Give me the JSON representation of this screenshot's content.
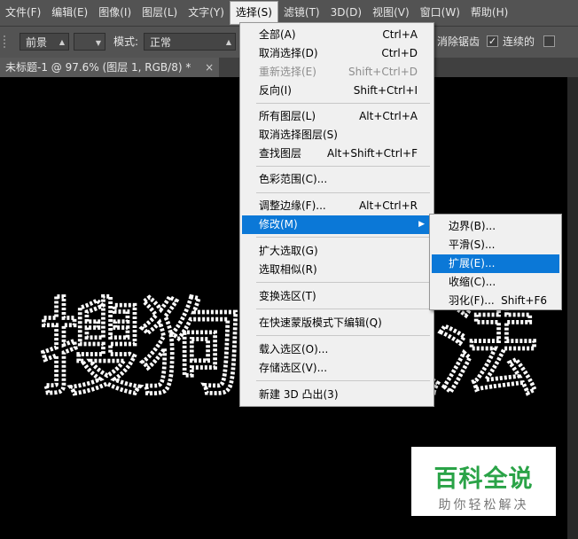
{
  "menubar": {
    "items": [
      {
        "label": "文件(F)",
        "active": false
      },
      {
        "label": "编辑(E)",
        "active": false
      },
      {
        "label": "图像(I)",
        "active": false
      },
      {
        "label": "图层(L)",
        "active": false
      },
      {
        "label": "文字(Y)",
        "active": false
      },
      {
        "label": "选择(S)",
        "active": true
      },
      {
        "label": "滤镜(T)",
        "active": false
      },
      {
        "label": "3D(D)",
        "active": false
      },
      {
        "label": "视图(V)",
        "active": false
      },
      {
        "label": "窗口(W)",
        "active": false
      },
      {
        "label": "帮助(H)",
        "active": false
      }
    ]
  },
  "options": {
    "foreground_select": "前景",
    "mode_label": "模式:",
    "mode_value": "正常",
    "antialias_label": "消除锯齿",
    "contiguous_label": "连续的",
    "contiguous_checked": true
  },
  "document_tab": {
    "title": "未标题-1 @ 97.6% (图层 1, RGB/8) *",
    "close": "×"
  },
  "select_menu": {
    "items": [
      {
        "label": "全部(A)",
        "shortcut": "Ctrl+A"
      },
      {
        "label": "取消选择(D)",
        "shortcut": "Ctrl+D"
      },
      {
        "label": "重新选择(E)",
        "shortcut": "Shift+Ctrl+D",
        "disabled": true
      },
      {
        "label": "反向(I)",
        "shortcut": "Shift+Ctrl+I"
      },
      {
        "label": "所有图层(L)",
        "shortcut": "Alt+Ctrl+A"
      },
      {
        "label": "取消选择图层(S)",
        "shortcut": ""
      },
      {
        "label": "查找图层",
        "shortcut": "Alt+Shift+Ctrl+F"
      },
      {
        "label": "色彩范围(C)...",
        "shortcut": ""
      },
      {
        "label": "调整边缘(F)...",
        "shortcut": "Alt+Ctrl+R"
      },
      {
        "label": "修改(M)",
        "shortcut": "",
        "highlighted": true,
        "submenu": true
      },
      {
        "label": "扩大选取(G)",
        "shortcut": ""
      },
      {
        "label": "选取相似(R)",
        "shortcut": ""
      },
      {
        "label": "变换选区(T)",
        "shortcut": ""
      },
      {
        "label": "在快速蒙版模式下编辑(Q)",
        "shortcut": ""
      },
      {
        "label": "载入选区(O)...",
        "shortcut": ""
      },
      {
        "label": "存储选区(V)...",
        "shortcut": ""
      },
      {
        "label": "新建 3D 凸出(3)",
        "shortcut": ""
      }
    ]
  },
  "modify_submenu": {
    "items": [
      {
        "label": "边界(B)...",
        "shortcut": ""
      },
      {
        "label": "平滑(S)...",
        "shortcut": ""
      },
      {
        "label": "扩展(E)...",
        "shortcut": "",
        "highlighted": true
      },
      {
        "label": "收缩(C)...",
        "shortcut": ""
      },
      {
        "label": "羽化(F)...",
        "shortcut": "Shift+F6"
      }
    ]
  },
  "canvas": {
    "selection_text": "搜狗输入法"
  },
  "watermark": {
    "title": "百科全说",
    "subtitle": "助你轻松解决"
  },
  "colors": {
    "accent": "#0b78d7",
    "watermark_green": "#2aa347",
    "panel_bg": "#535353",
    "canvas_bg": "#000000"
  }
}
